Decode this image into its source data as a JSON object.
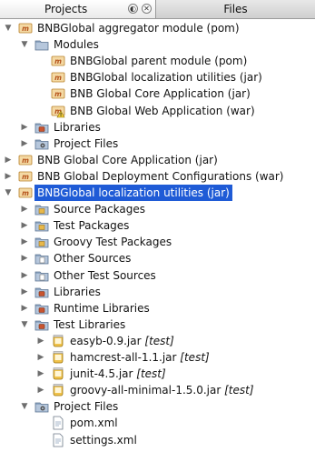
{
  "tabs": {
    "projects": "Projects",
    "files": "Files"
  },
  "tab_buttons": {
    "minimize": "◐",
    "close": "✕"
  },
  "tree": [
    {
      "label": "BNBGlobal aggregator module (pom)",
      "level": 0,
      "toggle": "expanded",
      "icon": "maven-project-icon"
    },
    {
      "label": "Modules",
      "level": 1,
      "toggle": "expanded",
      "icon": "folder-icon"
    },
    {
      "label": "BNBGlobal parent module (pom)",
      "level": 2,
      "toggle": "none",
      "icon": "maven-project-icon"
    },
    {
      "label": "BNBGlobal localization utilities (jar)",
      "level": 2,
      "toggle": "none",
      "icon": "maven-project-icon"
    },
    {
      "label": "BNB Global Core Application (jar)",
      "level": 2,
      "toggle": "none",
      "icon": "maven-project-icon"
    },
    {
      "label": "BNB Global Web Application (war)",
      "level": 2,
      "toggle": "none",
      "icon": "maven-project-warning-icon"
    },
    {
      "label": "Libraries",
      "level": 1,
      "toggle": "collapsed",
      "icon": "libraries-folder-icon"
    },
    {
      "label": "Project Files",
      "level": 1,
      "toggle": "collapsed",
      "icon": "project-files-folder-icon"
    },
    {
      "label": "BNB Global Core Application (jar)",
      "level": 0,
      "toggle": "collapsed",
      "icon": "maven-project-icon"
    },
    {
      "label": "BNB Global Deployment Configurations (war)",
      "level": 0,
      "toggle": "collapsed",
      "icon": "maven-project-icon"
    },
    {
      "label": "BNBGlobal localization utilities (jar)",
      "level": 0,
      "toggle": "expanded",
      "icon": "maven-project-icon",
      "selected": true
    },
    {
      "label": "Source Packages",
      "level": 1,
      "toggle": "collapsed",
      "icon": "package-folder-icon"
    },
    {
      "label": "Test Packages",
      "level": 1,
      "toggle": "collapsed",
      "icon": "package-folder-icon"
    },
    {
      "label": "Groovy Test Packages",
      "level": 1,
      "toggle": "collapsed",
      "icon": "package-folder-icon"
    },
    {
      "label": "Other Sources",
      "level": 1,
      "toggle": "collapsed",
      "icon": "sources-folder-icon"
    },
    {
      "label": "Other Test Sources",
      "level": 1,
      "toggle": "collapsed",
      "icon": "sources-folder-icon"
    },
    {
      "label": "Libraries",
      "level": 1,
      "toggle": "collapsed",
      "icon": "libraries-folder-icon"
    },
    {
      "label": "Runtime Libraries",
      "level": 1,
      "toggle": "collapsed",
      "icon": "libraries-folder-icon"
    },
    {
      "label": "Test Libraries",
      "level": 1,
      "toggle": "expanded",
      "icon": "libraries-folder-icon"
    },
    {
      "label": "easyb-0.9.jar",
      "tag": "[test]",
      "level": 2,
      "toggle": "collapsed",
      "icon": "jar-icon"
    },
    {
      "label": "hamcrest-all-1.1.jar",
      "tag": "[test]",
      "level": 2,
      "toggle": "collapsed",
      "icon": "jar-icon"
    },
    {
      "label": "junit-4.5.jar",
      "tag": "[test]",
      "level": 2,
      "toggle": "collapsed",
      "icon": "jar-icon"
    },
    {
      "label": "groovy-all-minimal-1.5.0.jar",
      "tag": "[test]",
      "level": 2,
      "toggle": "collapsed",
      "icon": "jar-icon"
    },
    {
      "label": "Project Files",
      "level": 1,
      "toggle": "expanded",
      "icon": "project-files-folder-icon"
    },
    {
      "label": "pom.xml",
      "level": 2,
      "toggle": "none",
      "icon": "xml-file-icon"
    },
    {
      "label": "settings.xml",
      "level": 2,
      "toggle": "none",
      "icon": "xml-file-icon"
    }
  ],
  "colors": {
    "selection": "#1f5bd6",
    "folder": "#8fa6c2",
    "maven_orange": "#e8a33c",
    "jar": "#f0c24a"
  }
}
